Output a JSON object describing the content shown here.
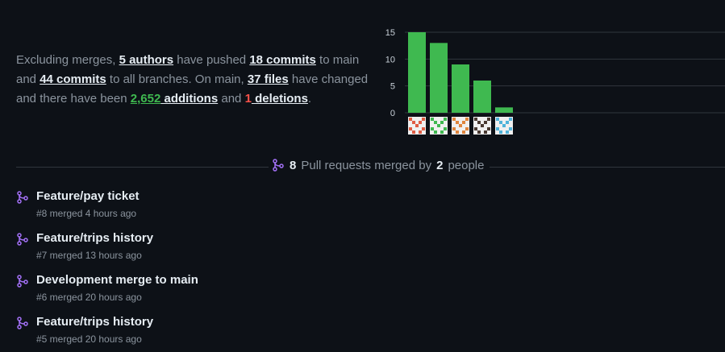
{
  "summary": {
    "t1": "Excluding merges, ",
    "authors": "5 authors",
    "t2": " have pushed ",
    "commits_main": "18 commits",
    "t3": " to main and ",
    "commits_all": "44 commits",
    "t4": " to all branches. On main, ",
    "files": "37 files",
    "t5": " have changed and there have been ",
    "additions_num": "2,652",
    "additions_word": " additions",
    "t6": " and ",
    "deletions_num": "1",
    "deletions_word": " deletions",
    "t7": "."
  },
  "chart_data": {
    "type": "bar",
    "categories": [
      "author-1",
      "author-2",
      "author-3",
      "author-4",
      "author-5"
    ],
    "values": [
      15,
      13,
      9,
      6,
      1
    ],
    "yticks": [
      0,
      5,
      10,
      15
    ],
    "ylim": [
      0,
      15
    ],
    "bar_color": "#3fb950",
    "grid": true,
    "avatar_colors": [
      "#e05d44",
      "#3fb950",
      "#e0853d",
      "#4a3a32",
      "#4fb3d9"
    ]
  },
  "pulls": {
    "count": "8",
    "label": "Pull requests merged by",
    "people": "2",
    "people_label": "people",
    "items": [
      {
        "title": "Feature/pay ticket",
        "meta": "#8 merged 4 hours ago"
      },
      {
        "title": "Feature/trips history",
        "meta": "#7 merged 13 hours ago"
      },
      {
        "title": "Development merge to main",
        "meta": "#6 merged 20 hours ago"
      },
      {
        "title": "Feature/trips history",
        "meta": "#5 merged 20 hours ago"
      }
    ]
  },
  "colors": {
    "background": "#0d1117",
    "merge_icon": "#a371f7",
    "additions": "#3fb950",
    "deletions": "#f85149"
  }
}
